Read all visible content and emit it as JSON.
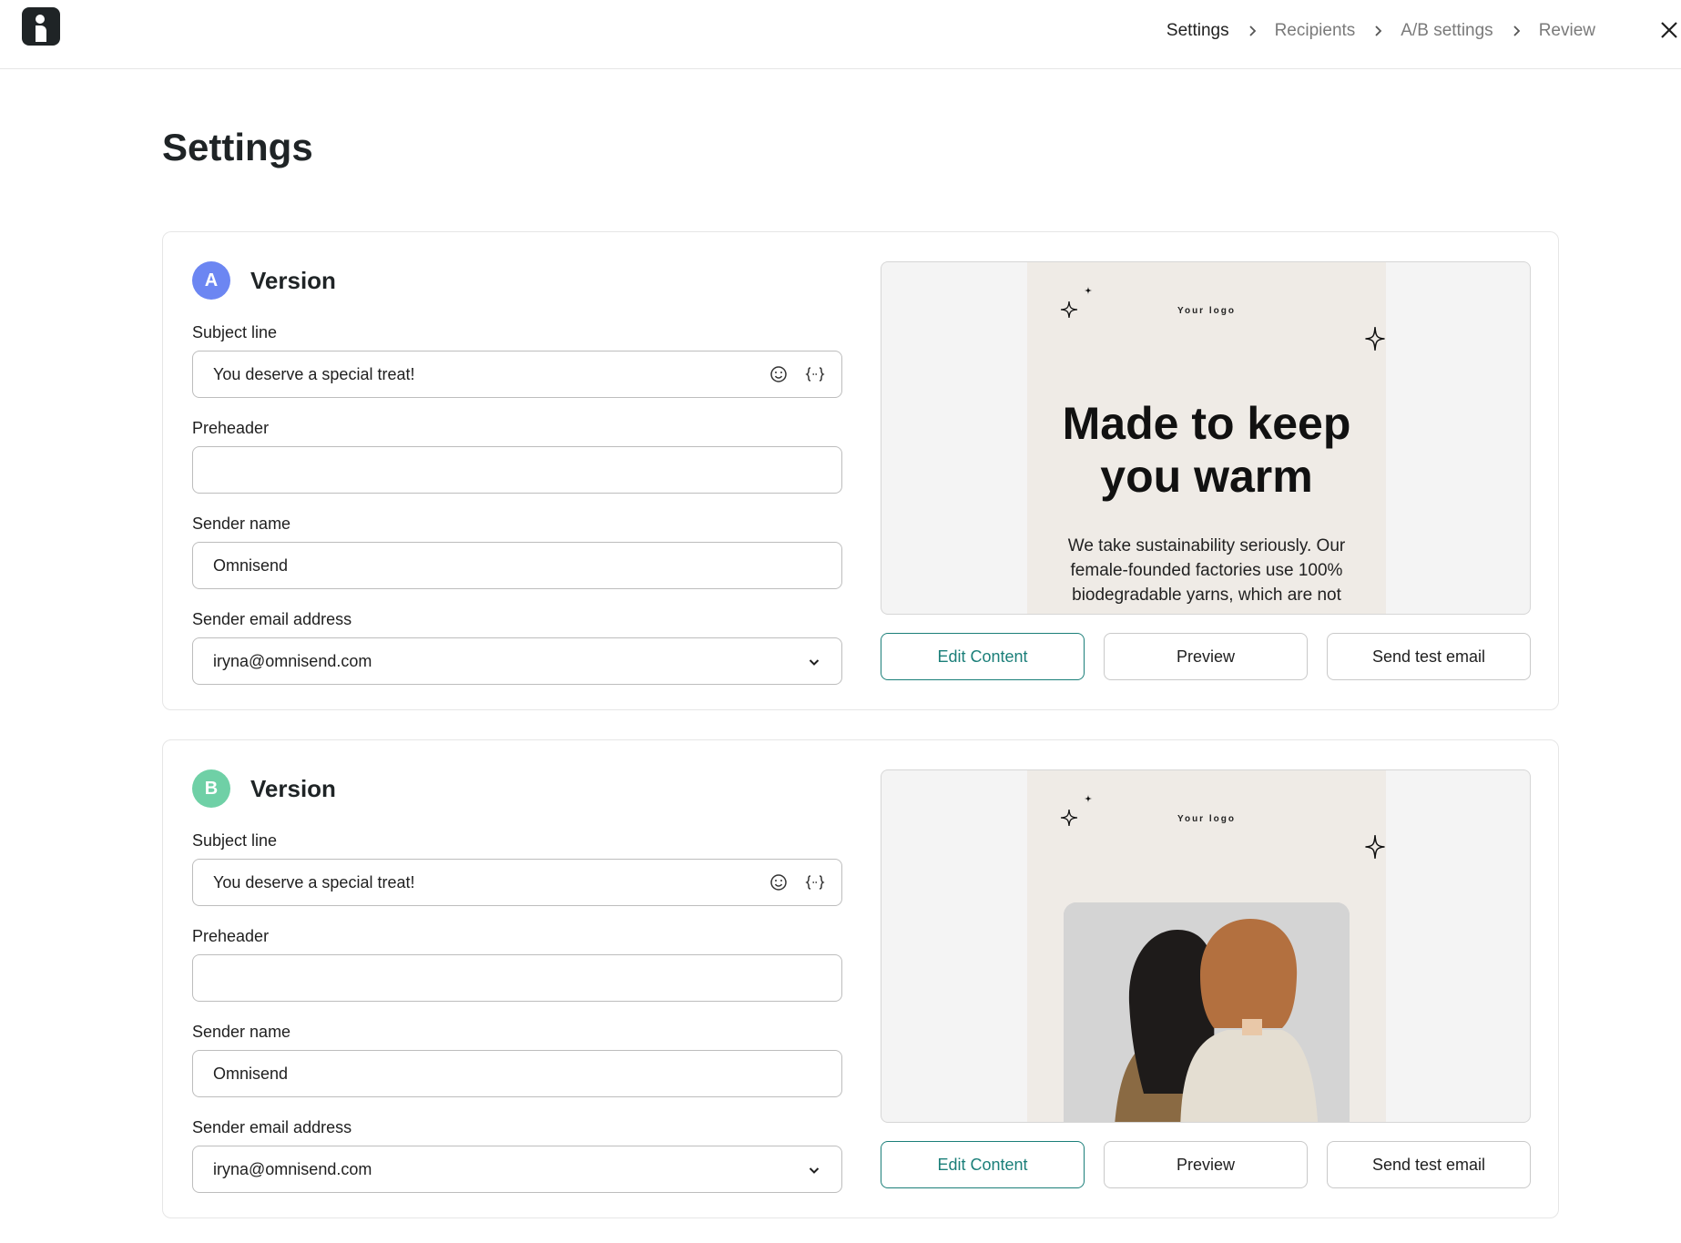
{
  "header": {
    "logo_icon": "omnisend-logo-icon",
    "breadcrumb": [
      "Settings",
      "Recipients",
      "A/B settings",
      "Review"
    ],
    "active_step": "Settings",
    "close_icon": "close-icon"
  },
  "page": {
    "title": "Settings"
  },
  "colors": {
    "version_a": "#6c86f2",
    "version_b": "#6fd0a6",
    "accent": "#1b7f79"
  },
  "labels": {
    "subject_line": "Subject line",
    "preheader": "Preheader",
    "sender_name": "Sender name",
    "sender_email": "Sender email address"
  },
  "actions": {
    "edit": "Edit Content",
    "preview": "Preview",
    "send_test": "Send test email"
  },
  "versions": [
    {
      "badge": "A",
      "title": "Version",
      "subject_line": "You deserve a special treat!",
      "preheader": "",
      "sender_name": "Omnisend",
      "sender_email": "iryna@omnisend.com",
      "preview": {
        "logo_text": "Your logo",
        "headline": "Made to keep you warm",
        "body": "We take sustainability seriously. Our female-founded factories use 100% biodegradable yarns, which are not"
      }
    },
    {
      "badge": "B",
      "title": "Version",
      "subject_line": "You deserve a special treat!",
      "preheader": "",
      "sender_name": "Omnisend",
      "sender_email": "iryna@omnisend.com",
      "preview": {
        "logo_text": "Your logo",
        "image": "two-women-in-sweaters-photo"
      }
    }
  ]
}
